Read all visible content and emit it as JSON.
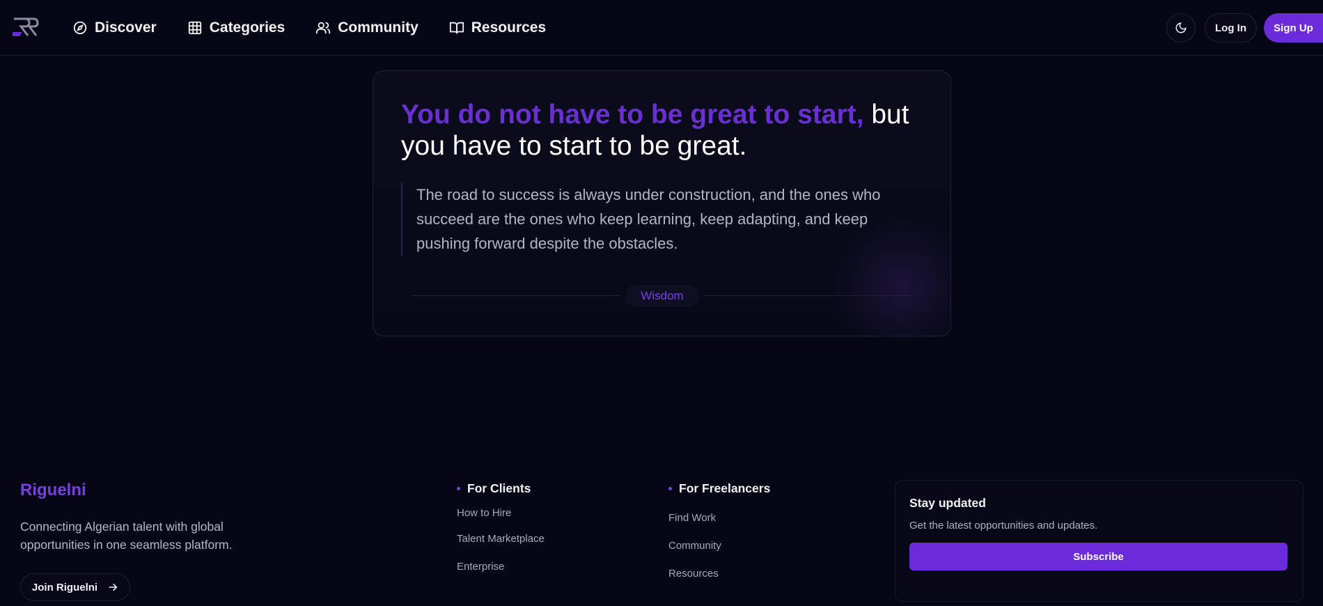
{
  "nav": {
    "logo_icon": "rr-logo-icon",
    "links": [
      {
        "label": "Discover",
        "icon": "compass-icon"
      },
      {
        "label": "Categories",
        "icon": "grid-icon"
      },
      {
        "label": "Community",
        "icon": "users-icon"
      },
      {
        "label": "Resources",
        "icon": "book-open-icon"
      }
    ],
    "theme_icon": "moon-icon",
    "login_label": "Log In",
    "signup_label": "Sign Up"
  },
  "quote": {
    "highlight": "You do not have to be great to start,",
    "rest": " but you have to start to be great.",
    "body": "The road to success is always under construction, and the ones who succeed are the ones who keep learning, keep adapting, and keep pushing forward despite the obstacles.",
    "tag": "Wisdom"
  },
  "footer": {
    "brand": "Riguelni",
    "description": "Connecting Algerian talent with global opportunities in one seamless platform.",
    "join_label": "Join Riguelni",
    "clients": {
      "title": "For Clients",
      "links": [
        "How to Hire",
        "Talent Marketplace",
        "Enterprise"
      ]
    },
    "freelancers": {
      "title": "For Freelancers",
      "links": [
        "Find Work",
        "Community",
        "Resources"
      ]
    },
    "newsletter": {
      "title": "Stay updated",
      "description": "Get the latest opportunities and updates.",
      "button": "Subscribe"
    }
  },
  "colors": {
    "background": "#050714",
    "accent": "#6c2bd9",
    "accent_text": "#7a3fe0"
  }
}
